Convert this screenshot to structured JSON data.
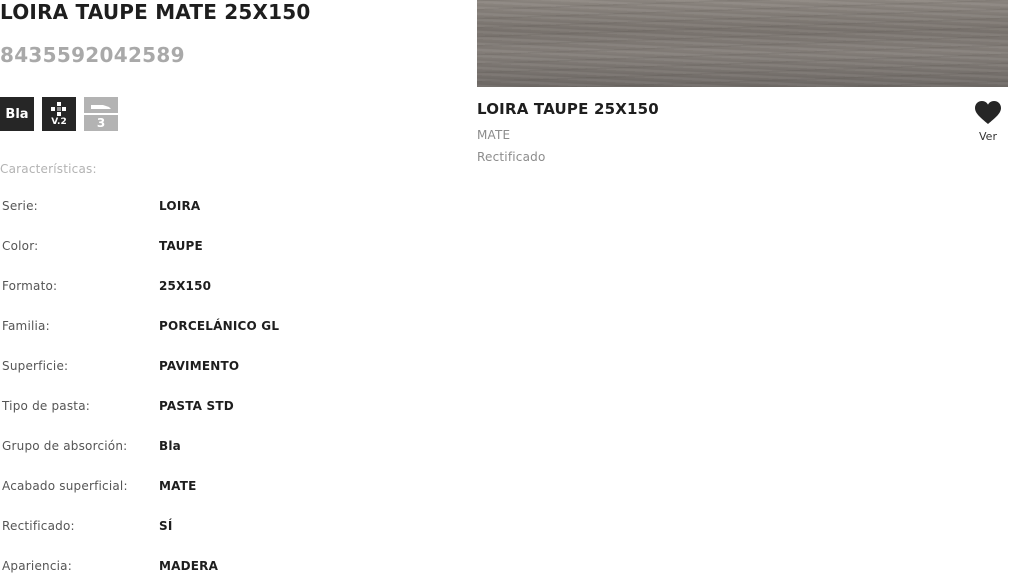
{
  "product": {
    "title": "LOIRA TAUPE MATE 25X150",
    "ean": "8435592042589"
  },
  "badges": {
    "absorption": "Bla",
    "variation": "V.2",
    "slip_level": "3"
  },
  "characteristics": {
    "label": "Características:",
    "rows": [
      {
        "key": "Serie:",
        "value": "LOIRA"
      },
      {
        "key": "Color:",
        "value": "TAUPE"
      },
      {
        "key": "Formato:",
        "value": "25X150"
      },
      {
        "key": "Familia:",
        "value": "PORCELÁNICO GL"
      },
      {
        "key": "Superficie:",
        "value": "PAVIMENTO"
      },
      {
        "key": "Tipo de pasta:",
        "value": "PASTA STD"
      },
      {
        "key": "Grupo de absorción:",
        "value": "Bla"
      },
      {
        "key": "Acabado superficial:",
        "value": "MATE"
      },
      {
        "key": "Rectificado:",
        "value": "SÍ"
      },
      {
        "key": "Apariencia:",
        "value": "MADERA"
      }
    ]
  },
  "related_card": {
    "title": "LOIRA TAUPE 25X150",
    "finish": "MATE",
    "edge": "Rectificado",
    "favorite_label": "Ver",
    "favorite_icon": "heart-icon"
  },
  "colors": {
    "dark_badge": "#262626",
    "light_badge": "#b3b3b3",
    "ean_gray": "#a9a9a9",
    "muted_text": "#8c8c8c"
  }
}
